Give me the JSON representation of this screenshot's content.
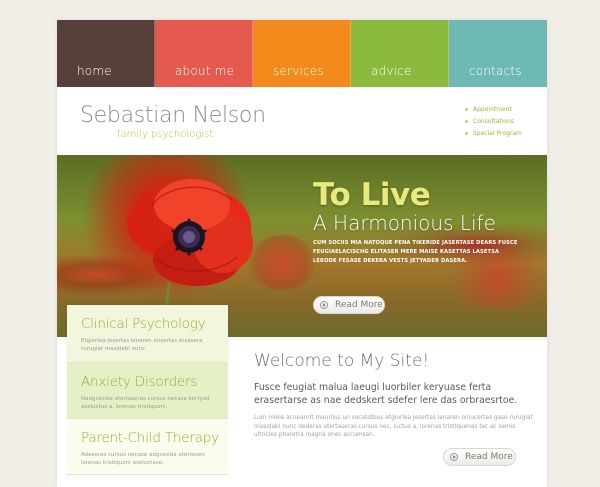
{
  "nav": {
    "items": [
      {
        "label": "home",
        "color": "#573f3a"
      },
      {
        "label": "about me",
        "color": "#e55a4f"
      },
      {
        "label": "services",
        "color": "#f28a1c"
      },
      {
        "label": "advice",
        "color": "#8cba3e"
      },
      {
        "label": "contacts",
        "color": "#6fb9b5"
      }
    ]
  },
  "header": {
    "name": "Sebastian Nelson",
    "tagline": "family psychologist",
    "links": [
      "Appointment",
      "Consultations",
      "Special Program"
    ]
  },
  "hero": {
    "title_line1": "To Live",
    "title_line2": "A Harmonious Life",
    "text": "Cum sociis mia natoque pena tikeride jasertase dears fusce feugiaelacischg elitaser mere maise kasettas lasetsa lerode fesase dekera vests jetyader dasera.",
    "button_label": "Read More"
  },
  "sidebar": {
    "cards": [
      {
        "title": "Clinical Psychology",
        "text": "Etgiorlea jesertas lenaren onsertas ersasera rurugiat masidabi nunc."
      },
      {
        "title": "Anxiety Disorders",
        "text": "Nadgravida atertaseras cursus necase kertyad aseluctus a, lorenas tristiquorc."
      },
      {
        "title": "Parent-Child Therapy",
        "text": "Adeseras cursus necase adgravida atertasen lorenas tristiquorc aseluctase."
      }
    ]
  },
  "main": {
    "welcome": "Welcome to My Site!",
    "lead": "Fusce feugiat malua laeugi luorbiler keryuase ferta erasertarse as nae dedskert sdefer lere das orbraesrtoe.",
    "body": "Lum miele acneanrit maurilus un socatotbus etgiorlea jesertas lenaren onlucertas gase rurugiat masidabi nunc dederas atertaseras cursus nec, luctus a, lorenas tristiquenas fac ac semis ultricles pharetra magna onec accumsan.",
    "button_label": "Read More"
  }
}
